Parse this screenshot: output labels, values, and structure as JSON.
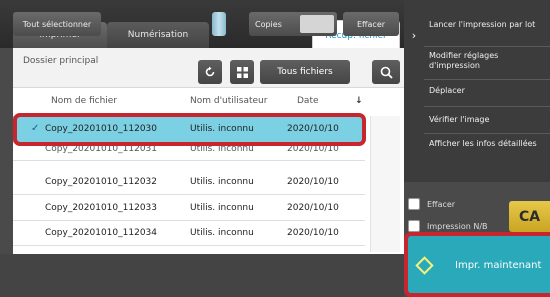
{
  "tabs": {
    "print": "Imprimer",
    "scan": "Numérisation",
    "recall": "Récup. fichier"
  },
  "folder": {
    "label": "Dossier principal"
  },
  "toolbar": {
    "filter_label": "Tous fichiers"
  },
  "table": {
    "headers": {
      "file_name": "Nom de fichier",
      "user_name": "Nom d'utilisateur",
      "date": "Date",
      "sort": "↓"
    },
    "rows": [
      {
        "file": "Copy_20201010_112030",
        "user": "Utilis. inconnu",
        "date": "2020/10/10",
        "selected": true
      },
      {
        "file": "Copy_20201010_112031",
        "user": "Utilis. inconnu",
        "date": "2020/10/10",
        "selected": false
      },
      {
        "file": "Copy_20201010_112032",
        "user": "Utilis. inconnu",
        "date": "2020/10/10",
        "selected": false
      },
      {
        "file": "Copy_20201010_112033",
        "user": "Utilis. inconnu",
        "date": "2020/10/10",
        "selected": false
      },
      {
        "file": "Copy_20201010_112034",
        "user": "Utilis. inconnu",
        "date": "2020/10/10",
        "selected": false
      }
    ]
  },
  "bottom": {
    "select_all": "Tout sélectionner",
    "copies": "Copies",
    "delete": "Effacer"
  },
  "side_actions": {
    "batch_print": "Lancer l'impression par lot",
    "modify_settings": "Modifier réglages d'impression",
    "move": "Déplacer",
    "check_image": "Vérifier l'image",
    "show_details": "Afficher les infos détaillées"
  },
  "options": {
    "erase": "Effacer",
    "bw_print": "Impression N/B"
  },
  "buttons": {
    "ca": "CA",
    "print_now": "Impr. maintenant"
  },
  "colors": {
    "accent": "#1d8fc7",
    "selected_row": "#7bd0e3",
    "highlight_frame": "#c8262f",
    "start_button": "#2aa9ba",
    "ca_button": "#d9b835"
  }
}
